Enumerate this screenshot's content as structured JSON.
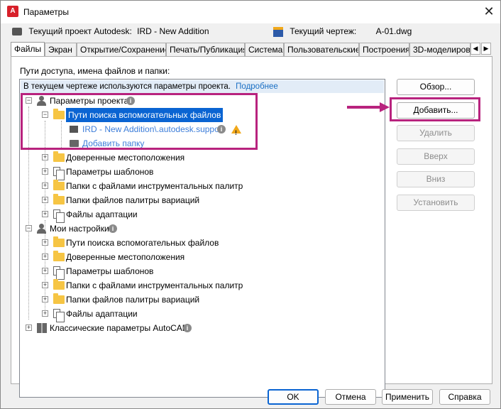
{
  "window": {
    "title": "Параметры",
    "app_icon_text": "A",
    "close_glyph": "✕"
  },
  "project": {
    "label": "Текущий проект Autodesk:",
    "value": "IRD - New Addition",
    "drawing_label": "Текущий чертеж:",
    "drawing_value": "A-01.dwg"
  },
  "tabs": [
    {
      "label": "Файлы",
      "active": true
    },
    {
      "label": "Экран"
    },
    {
      "label": "Открытие/Сохранение"
    },
    {
      "label": "Печать/Публикация"
    },
    {
      "label": "Система"
    },
    {
      "label": "Пользовательские"
    },
    {
      "label": "Построения"
    },
    {
      "label": "3D-моделирова"
    }
  ],
  "tab_scroll": {
    "left": "◀",
    "right": "▶"
  },
  "files_panel": {
    "label": "Пути доступа, имена файлов и папки:",
    "banner_text": "В текущем чертеже используются параметры проекта.",
    "banner_link": "Подробнее"
  },
  "tree": {
    "project_root": "Параметры проекта",
    "support_paths": "Пути поиска вспомогательных файлов",
    "support_path_entry": "IRD - New Addition\\.autodesk.support",
    "add_folder": "Добавить папку",
    "project_children": [
      "Доверенные местоположения",
      "Параметры шаблонов",
      "Папки с файлами инструментальных палитр",
      "Папки файлов палитры вариаций",
      "Файлы адаптации"
    ],
    "my_settings_root": "Мои настройки",
    "my_children": [
      "Пути поиска вспомогательных файлов",
      "Доверенные местоположения",
      "Параметры шаблонов",
      "Папки с файлами инструментальных палитр",
      "Папки файлов палитры вариаций",
      "Файлы адаптации"
    ],
    "classic_root": "Классические параметры AutoCAD",
    "expanded_glyph": "−",
    "collapsed_glyph": "+",
    "info_glyph": "i",
    "warn_glyph": "!"
  },
  "side_buttons": {
    "browse": "Обзор...",
    "add": "Добавить...",
    "remove": "Удалить",
    "up": "Вверх",
    "down": "Вниз",
    "set": "Установить"
  },
  "bottom_buttons": {
    "ok": "OK",
    "cancel": "Отмена",
    "apply": "Применить",
    "help": "Справка"
  },
  "colors": {
    "highlight": "#b8237e",
    "selection": "#0a64d2",
    "link": "#1a6fc4",
    "folder": "#f6c544",
    "warning": "#f1a81a"
  }
}
